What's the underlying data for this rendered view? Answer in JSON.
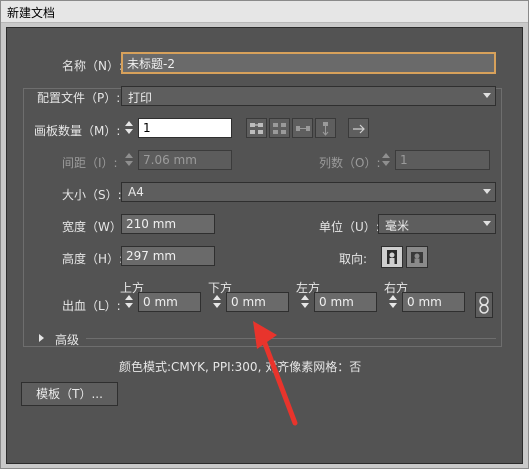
{
  "window": {
    "title": "新建文档"
  },
  "fields": {
    "name": {
      "label": "名称（N）:",
      "value": "未标题-2"
    },
    "profile": {
      "label": "配置文件（P）:",
      "value": "打印"
    },
    "artboards": {
      "label": "画板数量（M）:",
      "value": "1"
    },
    "spacing": {
      "label": "间距（I）:",
      "value": "7.06 mm"
    },
    "columns": {
      "label": "列数（O）:",
      "value": "1"
    },
    "size": {
      "label": "大小（S）:",
      "value": "A4"
    },
    "width": {
      "label": "宽度（W）:",
      "value": "210 mm"
    },
    "units": {
      "label": "单位（U）:",
      "value": "毫米"
    },
    "height": {
      "label": "高度（H）:",
      "value": "297 mm"
    },
    "orientation": {
      "label": "取向:"
    },
    "bleed": {
      "label": "出血（L）:",
      "top": {
        "label": "上方",
        "value": "0 mm"
      },
      "bottom": {
        "label": "下方",
        "value": "0 mm"
      },
      "left": {
        "label": "左方",
        "value": "0 mm"
      },
      "right": {
        "label": "右方",
        "value": "0 mm"
      }
    }
  },
  "advanced": {
    "label": "高级",
    "summary": "颜色模式:CMYK, PPI:300, 对齐像素网格：否"
  },
  "buttons": {
    "templates": "模板（T）..."
  },
  "colors": {
    "panel": "#535353",
    "focus_border": "#d7a15b",
    "annotation_arrow": "#e8342c"
  }
}
